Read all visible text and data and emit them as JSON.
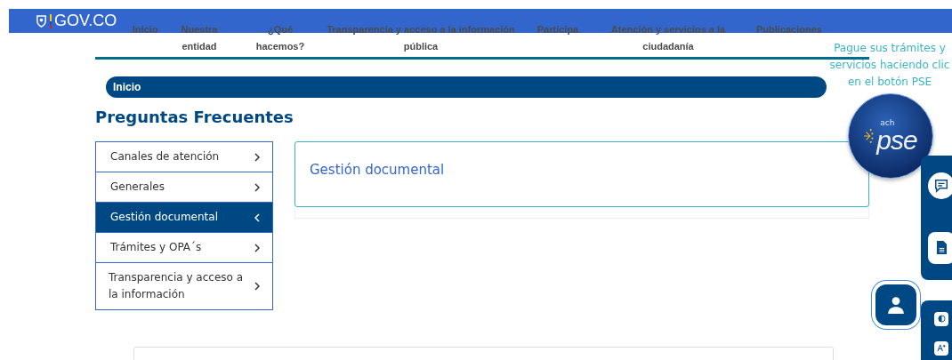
{
  "header": {
    "logo": "GOV.CO"
  },
  "nav": [
    "Inicio",
    "Nuestra entidad",
    "¿Qué hacemos?",
    "Transparencia y acceso a la información pública",
    "Participa",
    "Atención y servicios a la ciudadanía",
    "Publicaciones"
  ],
  "breadcrumb": "Inicio",
  "page_title": "Preguntas Frecuentes",
  "categories": [
    {
      "label": "Canales de atención",
      "selected": false
    },
    {
      "label": "Generales",
      "selected": false
    },
    {
      "label": "Gestión documental",
      "selected": true
    },
    {
      "label": "Trámites y OPA´s",
      "selected": false
    },
    {
      "label": "Transparencia y acceso a la información",
      "selected": false
    }
  ],
  "content": {
    "title": "Gestión documental"
  },
  "pse_promo": {
    "text": "Pague sus trámites y servicios haciendo clic en el botón PSE",
    "logo": "pse",
    "logo_prefix": "ach"
  }
}
